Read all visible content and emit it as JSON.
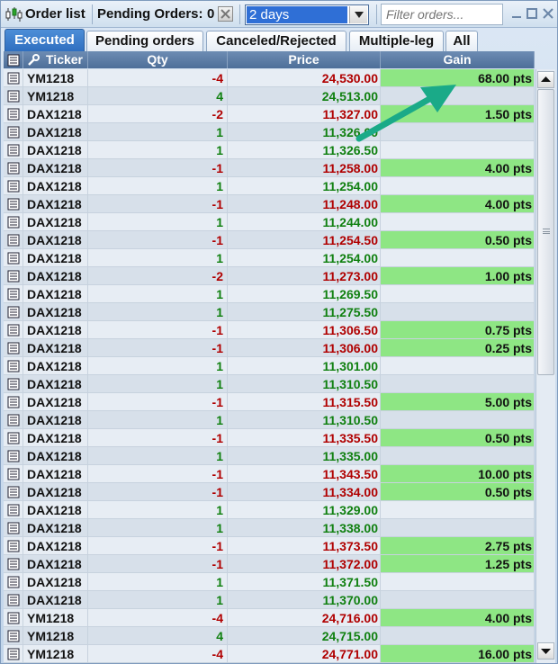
{
  "toolbar": {
    "title": "Order list",
    "pending_label": "Pending Orders:",
    "pending_count": "0",
    "period_selected": "2 days",
    "filter_placeholder": "Filter orders..."
  },
  "tabs": [
    {
      "label": "Executed",
      "active": true
    },
    {
      "label": "Pending orders",
      "active": false
    },
    {
      "label": "Canceled/Rejected",
      "active": false
    },
    {
      "label": "Multiple-leg",
      "active": false
    },
    {
      "label": "All",
      "active": false
    }
  ],
  "columns": {
    "ticker": "Ticker",
    "qty": "Qty",
    "price": "Price",
    "gain": "Gain"
  },
  "colors": {
    "negative": "#b00000",
    "positive": "#108010",
    "gain_fill": "#8ee684",
    "active_tab": "#2f6fc0",
    "annotation_arrow": "#1aaa88"
  },
  "icons": {
    "row": "document-icon",
    "header_doc": "document-icon",
    "header_settings": "wrench-icon",
    "app": "candlestick-icon"
  },
  "rows": [
    {
      "ticker": "YM1218",
      "qty": "-4",
      "price": "24,530.00",
      "gain": "68.00 pts"
    },
    {
      "ticker": "YM1218",
      "qty": "4",
      "price": "24,513.00",
      "gain": ""
    },
    {
      "ticker": "DAX1218",
      "qty": "-2",
      "price": "11,327.00",
      "gain": "1.50 pts"
    },
    {
      "ticker": "DAX1218",
      "qty": "1",
      "price": "11,326.00",
      "gain": ""
    },
    {
      "ticker": "DAX1218",
      "qty": "1",
      "price": "11,326.50",
      "gain": ""
    },
    {
      "ticker": "DAX1218",
      "qty": "-1",
      "price": "11,258.00",
      "gain": "4.00 pts"
    },
    {
      "ticker": "DAX1218",
      "qty": "1",
      "price": "11,254.00",
      "gain": ""
    },
    {
      "ticker": "DAX1218",
      "qty": "-1",
      "price": "11,248.00",
      "gain": "4.00 pts"
    },
    {
      "ticker": "DAX1218",
      "qty": "1",
      "price": "11,244.00",
      "gain": ""
    },
    {
      "ticker": "DAX1218",
      "qty": "-1",
      "price": "11,254.50",
      "gain": "0.50 pts"
    },
    {
      "ticker": "DAX1218",
      "qty": "1",
      "price": "11,254.00",
      "gain": ""
    },
    {
      "ticker": "DAX1218",
      "qty": "-2",
      "price": "11,273.00",
      "gain": "1.00 pts"
    },
    {
      "ticker": "DAX1218",
      "qty": "1",
      "price": "11,269.50",
      "gain": ""
    },
    {
      "ticker": "DAX1218",
      "qty": "1",
      "price": "11,275.50",
      "gain": ""
    },
    {
      "ticker": "DAX1218",
      "qty": "-1",
      "price": "11,306.50",
      "gain": "0.75 pts"
    },
    {
      "ticker": "DAX1218",
      "qty": "-1",
      "price": "11,306.00",
      "gain": "0.25 pts"
    },
    {
      "ticker": "DAX1218",
      "qty": "1",
      "price": "11,301.00",
      "gain": ""
    },
    {
      "ticker": "DAX1218",
      "qty": "1",
      "price": "11,310.50",
      "gain": ""
    },
    {
      "ticker": "DAX1218",
      "qty": "-1",
      "price": "11,315.50",
      "gain": "5.00 pts"
    },
    {
      "ticker": "DAX1218",
      "qty": "1",
      "price": "11,310.50",
      "gain": ""
    },
    {
      "ticker": "DAX1218",
      "qty": "-1",
      "price": "11,335.50",
      "gain": "0.50 pts"
    },
    {
      "ticker": "DAX1218",
      "qty": "1",
      "price": "11,335.00",
      "gain": ""
    },
    {
      "ticker": "DAX1218",
      "qty": "-1",
      "price": "11,343.50",
      "gain": "10.00 pts"
    },
    {
      "ticker": "DAX1218",
      "qty": "-1",
      "price": "11,334.00",
      "gain": "0.50 pts"
    },
    {
      "ticker": "DAX1218",
      "qty": "1",
      "price": "11,329.00",
      "gain": ""
    },
    {
      "ticker": "DAX1218",
      "qty": "1",
      "price": "11,338.00",
      "gain": ""
    },
    {
      "ticker": "DAX1218",
      "qty": "-1",
      "price": "11,373.50",
      "gain": "2.75 pts"
    },
    {
      "ticker": "DAX1218",
      "qty": "-1",
      "price": "11,372.00",
      "gain": "1.25 pts"
    },
    {
      "ticker": "DAX1218",
      "qty": "1",
      "price": "11,371.50",
      "gain": ""
    },
    {
      "ticker": "DAX1218",
      "qty": "1",
      "price": "11,370.00",
      "gain": ""
    },
    {
      "ticker": "YM1218",
      "qty": "-4",
      "price": "24,716.00",
      "gain": "4.00 pts"
    },
    {
      "ticker": "YM1218",
      "qty": "4",
      "price": "24,715.00",
      "gain": ""
    },
    {
      "ticker": "YM1218",
      "qty": "-4",
      "price": "24,771.00",
      "gain": "16.00 pts"
    }
  ]
}
